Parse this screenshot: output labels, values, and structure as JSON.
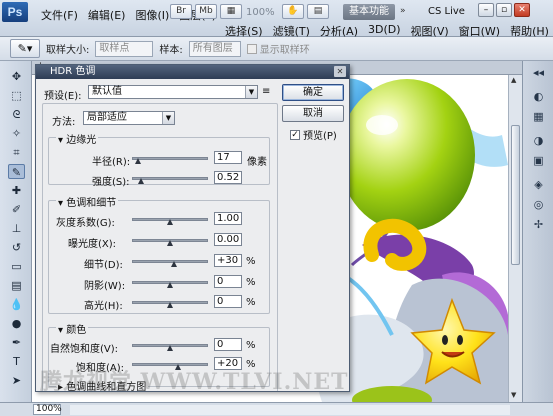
{
  "app": {
    "logo": "Ps",
    "menu": [
      "文件(F)",
      "编辑(E)",
      "图像(I)",
      "图层(L)",
      "选择(S)",
      "滤镜(T)",
      "分析(A)",
      "3D(D)",
      "视图(V)",
      "窗口(W)",
      "帮助(H)"
    ],
    "zoom_display": "100%",
    "workspace_label": "基本功能",
    "cs_live": "CS Live"
  },
  "options": {
    "sample_size_label": "取样大小:",
    "sample_size_value": "取样点",
    "sample_label": "样本:",
    "sample_value": "所有图层",
    "show_ring_label": "显示取样环"
  },
  "document": {
    "zoom_field": "100%"
  },
  "dialog": {
    "title": "HDR 色调",
    "preset_label": "预设(E):",
    "preset_value": "默认值",
    "ok_label": "确定",
    "cancel_label": "取消",
    "preview_label": "预览(P)",
    "preview_checked": true,
    "method_label": "方法:",
    "method_value": "局部适应",
    "edge_glow": {
      "title": "边缘光",
      "radius_label": "半径(R):",
      "radius_value": "17",
      "radius_unit": "像素",
      "radius_level": 0.08,
      "strength_label": "强度(S):",
      "strength_value": "0.52",
      "strength_level": 0.12
    },
    "tone_detail": {
      "title": "色调和细节",
      "gamma_label": "灰度系数(G):",
      "gamma_value": "1.00",
      "gamma_level": 0.5,
      "exposure_label": "曝光度(X):",
      "exposure_value": "0.00",
      "exposure_level": 0.5,
      "detail_label": "细节(D):",
      "detail_value": "+30",
      "detail_unit": "%",
      "detail_level": 0.55,
      "shadow_label": "阴影(W):",
      "shadow_value": "0",
      "shadow_unit": "%",
      "shadow_level": 0.5,
      "highlight_label": "高光(H):",
      "highlight_value": "0",
      "highlight_unit": "%",
      "highlight_level": 0.5
    },
    "color": {
      "title": "颜色",
      "vibrance_label": "自然饱和度(V):",
      "vibrance_value": "0",
      "vibrance_unit": "%",
      "vibrance_level": 0.5,
      "saturation_label": "饱和度(A):",
      "saturation_value": "+20",
      "saturation_unit": "%",
      "saturation_level": 0.6
    },
    "curve_section_title": "色调曲线和直方图"
  },
  "watermark": "腾龙视觉 WWW.TLVI.NET"
}
